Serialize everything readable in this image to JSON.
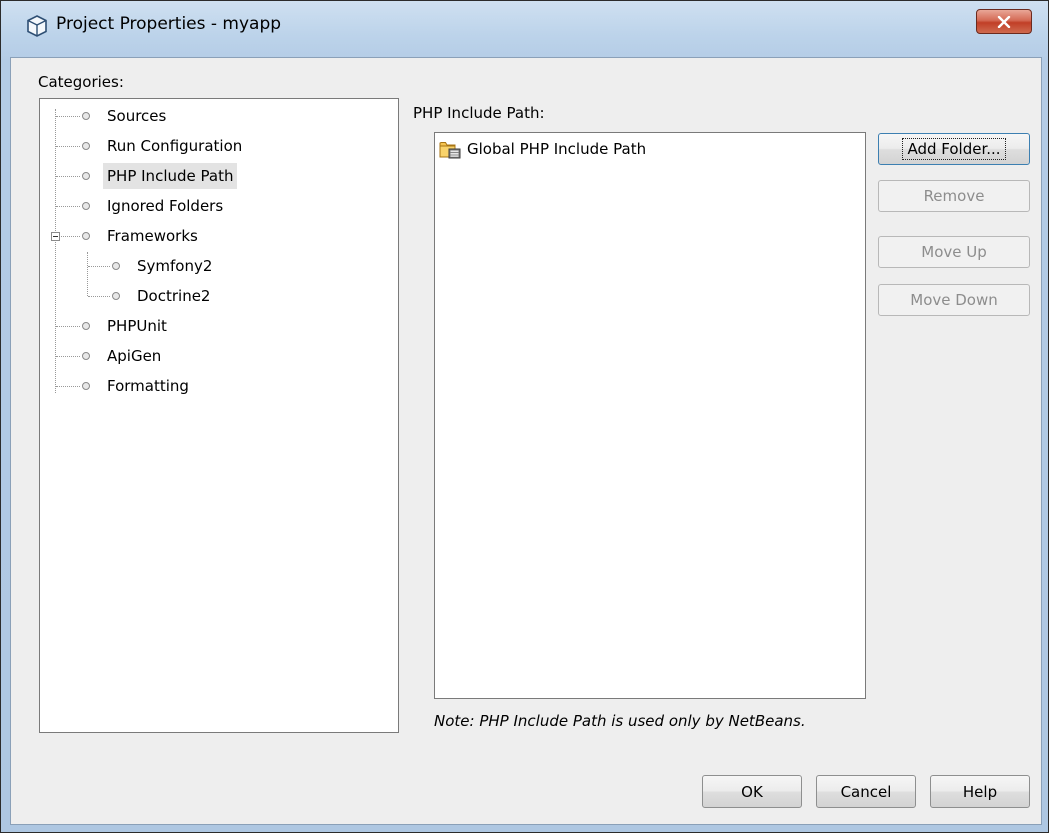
{
  "window": {
    "title": "Project Properties - myapp",
    "close_glyph": "x"
  },
  "categories": {
    "label": "Categories:",
    "items": [
      {
        "label": "Sources"
      },
      {
        "label": "Run Configuration"
      },
      {
        "label": "PHP Include Path",
        "selected": true
      },
      {
        "label": "Ignored Folders"
      },
      {
        "label": "Frameworks",
        "expanded": true
      },
      {
        "label": "Symfony2",
        "child": true
      },
      {
        "label": "Doctrine2",
        "child": true
      },
      {
        "label": "PHPUnit"
      },
      {
        "label": "ApiGen"
      },
      {
        "label": "Formatting"
      }
    ]
  },
  "include_path": {
    "label": "PHP Include Path:",
    "entries": [
      {
        "label": "Global PHP Include Path",
        "icon": "folder-library-icon"
      }
    ],
    "note": "Note: PHP Include Path is used only by NetBeans."
  },
  "side_buttons": {
    "add_folder": "Add Folder...",
    "remove": "Remove",
    "move_up": "Move Up",
    "move_down": "Move Down"
  },
  "dialog_buttons": {
    "ok": "OK",
    "cancel": "Cancel",
    "help": "Help"
  },
  "colors": {
    "titlebar": "#bcd3ea",
    "close_button": "#c13f27",
    "selection": "#e3e3e3"
  }
}
